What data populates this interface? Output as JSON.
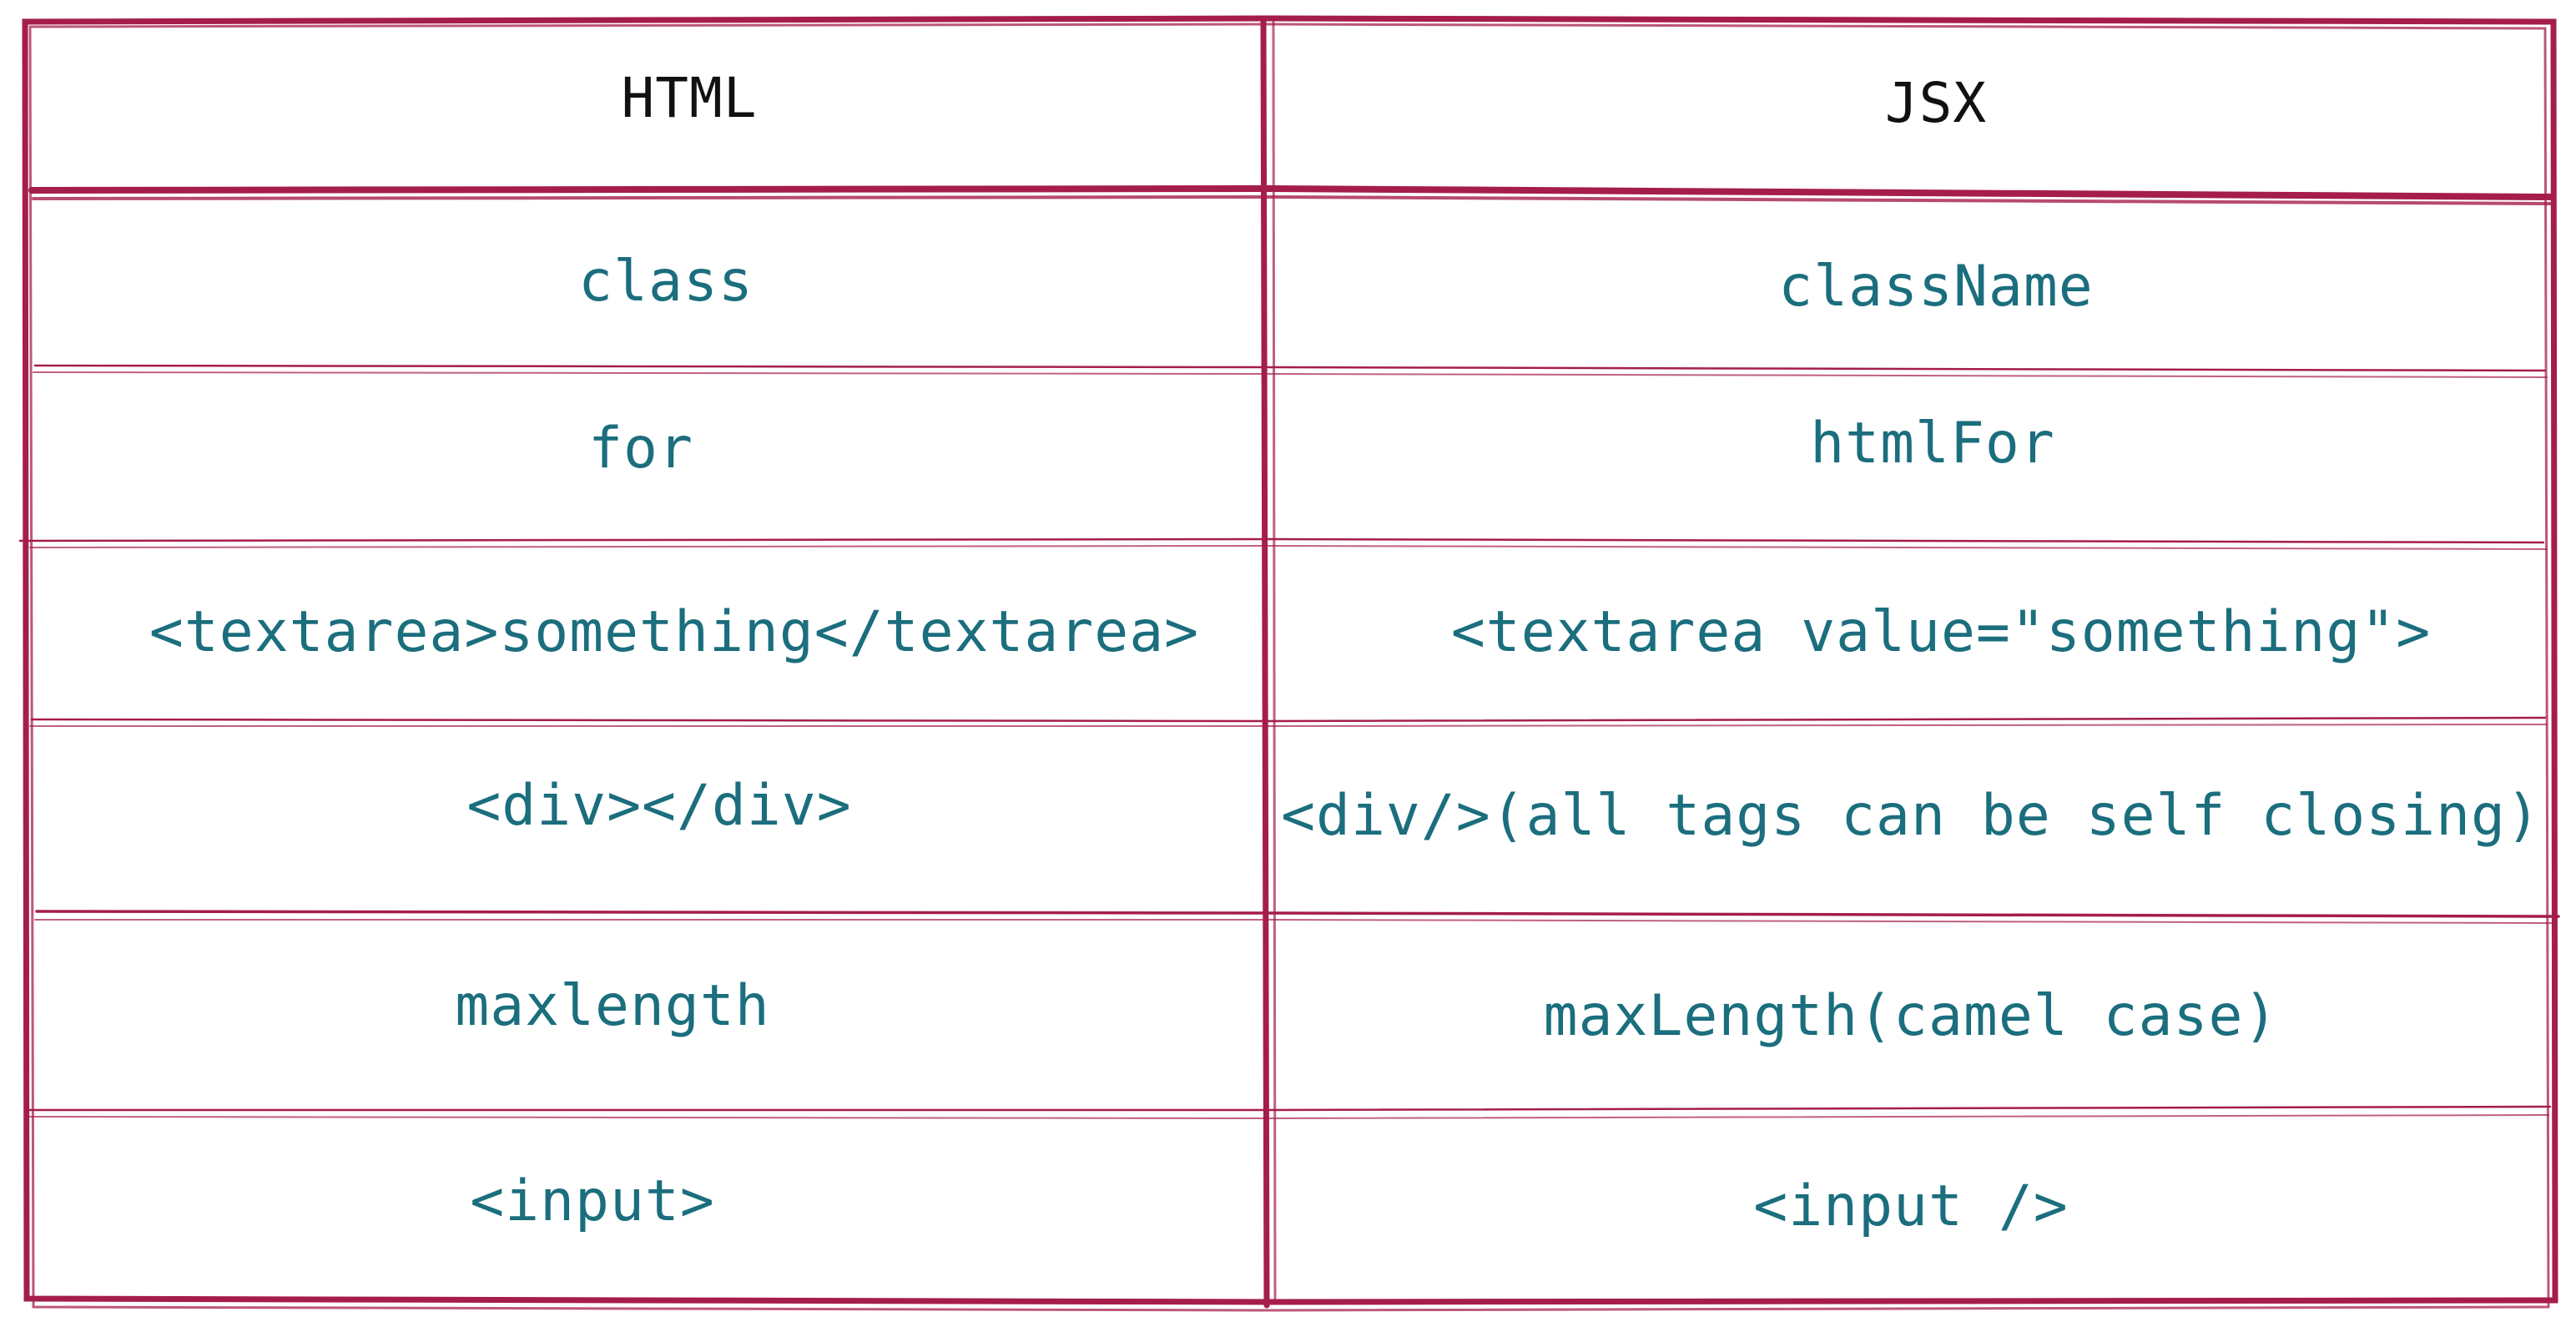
{
  "table": {
    "headers": [
      "HTML",
      "JSX"
    ],
    "rows": [
      {
        "html": "class",
        "jsx": "className"
      },
      {
        "html": "for",
        "jsx": "htmlFor"
      },
      {
        "html": "<textarea>something</textarea>",
        "jsx": "<textarea value=\"something\">"
      },
      {
        "html": "<div></div>",
        "jsx": "<div/>(all tags can be self closing)"
      },
      {
        "html": "maxlength",
        "jsx": "maxLength(camel case)"
      },
      {
        "html": "<input>",
        "jsx": "<input />"
      }
    ]
  },
  "colors": {
    "border": "#a51d4d",
    "text": "#1b6e7d",
    "header_text": "#111111",
    "background": "#ffffff"
  }
}
